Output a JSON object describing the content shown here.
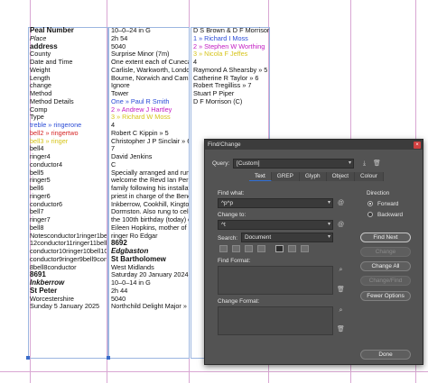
{
  "document": {
    "column1": [
      {
        "t": "Peal Number",
        "s": "b"
      },
      {
        "t": "Place",
        "s": "i"
      },
      {
        "t": "address",
        "s": "b"
      },
      {
        "t": "County"
      },
      {
        "t": "Date and Time"
      },
      {
        "t": "Weight"
      },
      {
        "t": "Length"
      },
      {
        "t": "change"
      },
      {
        "t": "Method"
      },
      {
        "t": "Method Details"
      },
      {
        "t": "Comp"
      },
      {
        "t": "Type"
      },
      {
        "t": "treble  »  ringerone",
        "s": "blue"
      },
      {
        "t": "bell2  »  ringertwo",
        "s": "red"
      },
      {
        "t": "bell3  »  ringer",
        "s": "yel"
      },
      {
        "t": "bell4"
      },
      {
        "t": "ringer4"
      },
      {
        "t": "conductor4"
      },
      {
        "t": "bell5"
      },
      {
        "t": "ringer5"
      },
      {
        "t": "bell6"
      },
      {
        "t": "ringer6"
      },
      {
        "t": "conductor6"
      },
      {
        "t": "bell7"
      },
      {
        "t": "ringer7"
      },
      {
        "t": "bell8"
      },
      {
        "t": "Notesconductor1ringer1bell8ringer8"
      },
      {
        "t": "12conductor11ringer11bell11notes"
      },
      {
        "t": "conductor10ringer10bell10ringer10bell"
      },
      {
        "t": "conductor9ringer9bell9conductor"
      },
      {
        "t": "8bell8conductor"
      },
      {
        "t": "8691",
        "s": "b"
      },
      {
        "t": "Inkberrow",
        "s": "bi"
      },
      {
        "t": "St Peter",
        "s": "b"
      },
      {
        "t": "Worcestershire"
      },
      {
        "t": "Sunday 5 January 2025"
      }
    ],
    "column2": [
      {
        "t": "10–0–24 in G"
      },
      {
        "t": "2h 54"
      },
      {
        "t": "5040"
      },
      {
        "t": "Surprise Minor (7m)"
      },
      {
        "t": "One extent each of Cunecastre,"
      },
      {
        "t": "Carlisle, Warkworth, London,"
      },
      {
        "t": "Bourne, Norwich and Cambridge"
      },
      {
        "t": "Ignore"
      },
      {
        "t": "Tower"
      },
      {
        "t": "One  »  Paul R Smith",
        "s": "blue"
      },
      {
        "t": "2  »  Andrew J Hartley",
        "s": "mag"
      },
      {
        "t": "3  »  Richard W Moss",
        "s": "yel"
      },
      {
        "t": "4"
      },
      {
        "t": "Robert C Kippin  »  5"
      },
      {
        "t": "Christopher J P Sinclair  »  6"
      },
      {
        "t": "7"
      },
      {
        "t": "David Jenkins"
      },
      {
        "t": "C"
      },
      {
        "t": "Specially arranged and rung to"
      },
      {
        "t": "welcome the Revd Ian Perry and"
      },
      {
        "t": "family following his installation as"
      },
      {
        "t": "priest in charge of the Benefice of"
      },
      {
        "t": "Inkberrow, Cookhill, Kington and"
      },
      {
        "t": "Dormston. Also rung to celebrate"
      },
      {
        "t": "the 100th birthday (today) of"
      },
      {
        "t": "Eileen Hopkins, mother of local"
      },
      {
        "t": "ringer Ro Edgar"
      },
      {
        "t": "8692",
        "s": "b"
      },
      {
        "t": "Edgbaston",
        "s": "bi"
      },
      {
        "t": "St Bartholomew",
        "s": "b"
      },
      {
        "t": "West Midlands"
      },
      {
        "t": "Saturday 20 January 2024"
      },
      {
        "t": "10–0–14 in G"
      },
      {
        "t": "2h 44"
      },
      {
        "t": "5040"
      },
      {
        "t": "Northchild Delight Major  »  R"
      }
    ],
    "column3": [
      {
        "t": "D S Brown & D F Morrison"
      },
      {
        "t": "1  »  Richard I Moss",
        "s": "blue"
      },
      {
        "t": "2  »  Stephen W Worthing",
        "s": "mag"
      },
      {
        "t": "3  »  Nicola F Jeffes",
        "s": "yel"
      },
      {
        "t": "4"
      },
      {
        "t": "Raymond A Shearsby  »  5"
      },
      {
        "t": "Catherine R Taylor  »  6"
      },
      {
        "t": "Robert Tregilliss  »  7"
      },
      {
        "t": "Stuart P Piper"
      },
      {
        "t": "D F Morrison (C)"
      }
    ]
  },
  "dialog": {
    "title": "Find/Change",
    "close_label": "×",
    "query_label": "Query:",
    "query_value": "[Custom]",
    "tabs": [
      "Text",
      "GREP",
      "Glyph",
      "Object",
      "Colour"
    ],
    "active_tab": "Text",
    "find_what_label": "Find what:",
    "find_what_value": "^p^p",
    "change_to_label": "Change to:",
    "change_to_value": "^t",
    "search_label": "Search:",
    "search_value": "Document",
    "find_format_label": "Find Format:",
    "change_format_label": "Change Format:",
    "direction_label": "Direction",
    "direction_options": [
      "Forward",
      "Backward"
    ],
    "direction_selected": "Forward",
    "buttons": {
      "find_next": "Find Next",
      "change": "Change",
      "change_all": "Change All",
      "change_find": "Change/Find",
      "fewer_options": "Fewer Options",
      "done": "Done"
    },
    "colors": {
      "panel": "#535353",
      "title_bar": "#3c3c3c",
      "close": "#d04040",
      "field": "#3a3a3a"
    }
  }
}
